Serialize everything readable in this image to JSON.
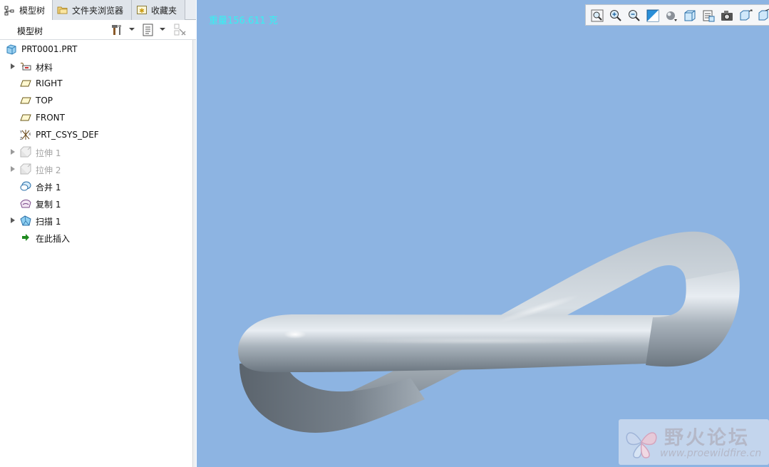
{
  "tabs": [
    {
      "label": "模型树",
      "icon": "model-tree-icon",
      "active": true
    },
    {
      "label": "文件夹浏览器",
      "icon": "folder-browser-icon",
      "active": false
    },
    {
      "label": "收藏夹",
      "icon": "favorites-icon",
      "active": false
    }
  ],
  "tree_header": {
    "title": "模型树",
    "tools": [
      "settings-icon",
      "show-options-icon",
      "filter-icon"
    ]
  },
  "tree": [
    {
      "label": "PRT0001.PRT",
      "icon": "part-icon",
      "expandable": false,
      "suppressed": false
    },
    {
      "label": "材料",
      "icon": "material-icon",
      "expandable": true,
      "suppressed": false
    },
    {
      "label": "RIGHT",
      "icon": "datum-plane-icon",
      "expandable": false,
      "suppressed": false
    },
    {
      "label": "TOP",
      "icon": "datum-plane-icon",
      "expandable": false,
      "suppressed": false
    },
    {
      "label": "FRONT",
      "icon": "datum-plane-icon",
      "expandable": false,
      "suppressed": false
    },
    {
      "label": "PRT_CSYS_DEF",
      "icon": "coordinate-system-icon",
      "expandable": false,
      "suppressed": false
    },
    {
      "label": "拉伸 1",
      "icon": "extrude-icon",
      "expandable": true,
      "suppressed": true
    },
    {
      "label": "拉伸 2",
      "icon": "extrude-icon",
      "expandable": true,
      "suppressed": true
    },
    {
      "label": "合并 1",
      "icon": "merge-icon",
      "expandable": false,
      "suppressed": false
    },
    {
      "label": "复制 1",
      "icon": "copy-icon",
      "expandable": false,
      "suppressed": false
    },
    {
      "label": "扫描 1",
      "icon": "sweep-icon",
      "expandable": true,
      "suppressed": false
    },
    {
      "label": "在此插入",
      "icon": "insert-here-arrow-icon",
      "expandable": false,
      "suppressed": false
    }
  ],
  "viewport": {
    "mass_readout": "重量156.611 克",
    "background_color": "#8db4e2",
    "readout_color": "#35f2f2",
    "toolbar": [
      "refit-icon",
      "zoom-in-icon",
      "zoom-out-icon",
      "repaint-icon",
      "display-style-icon",
      "saved-views-icon",
      "view-manager-icon",
      "camera-icon",
      "datum-display-icon",
      "spin-center-icon"
    ]
  },
  "watermark": {
    "title": "野火论坛",
    "url": "www.proewildfire.cn"
  }
}
